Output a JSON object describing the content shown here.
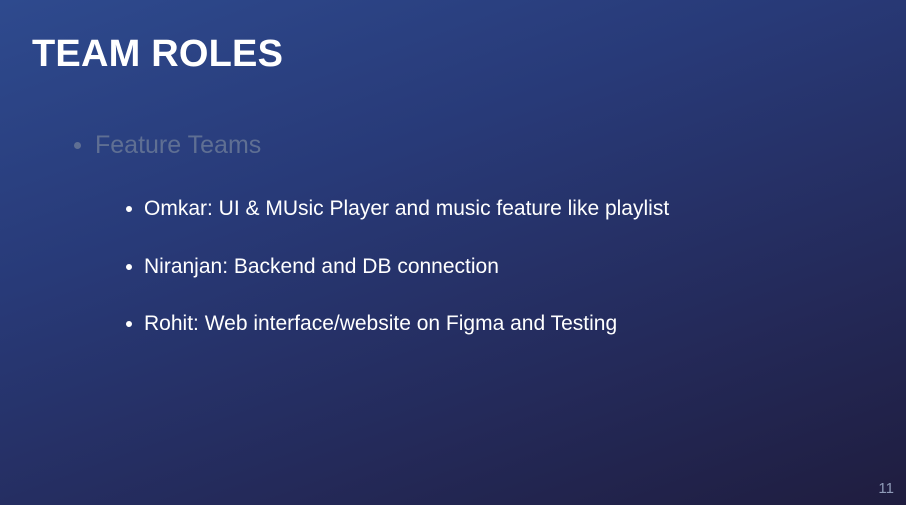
{
  "slide": {
    "title": "TEAM ROLES",
    "heading_bullet": "Feature Teams",
    "items": [
      "Omkar:  UI & MUsic Player and music feature like playlist",
      "Niranjan: Backend and DB connection",
      "Rohit: Web interface/website on Figma and Testing"
    ],
    "page_number": "11"
  },
  "colors": {
    "background_top": "#2e4a8e",
    "background_bottom": "#1f1d3f",
    "title": "#ffffff",
    "dimmed_text": "#5f6f93",
    "page_number": "#8f9bb8"
  }
}
